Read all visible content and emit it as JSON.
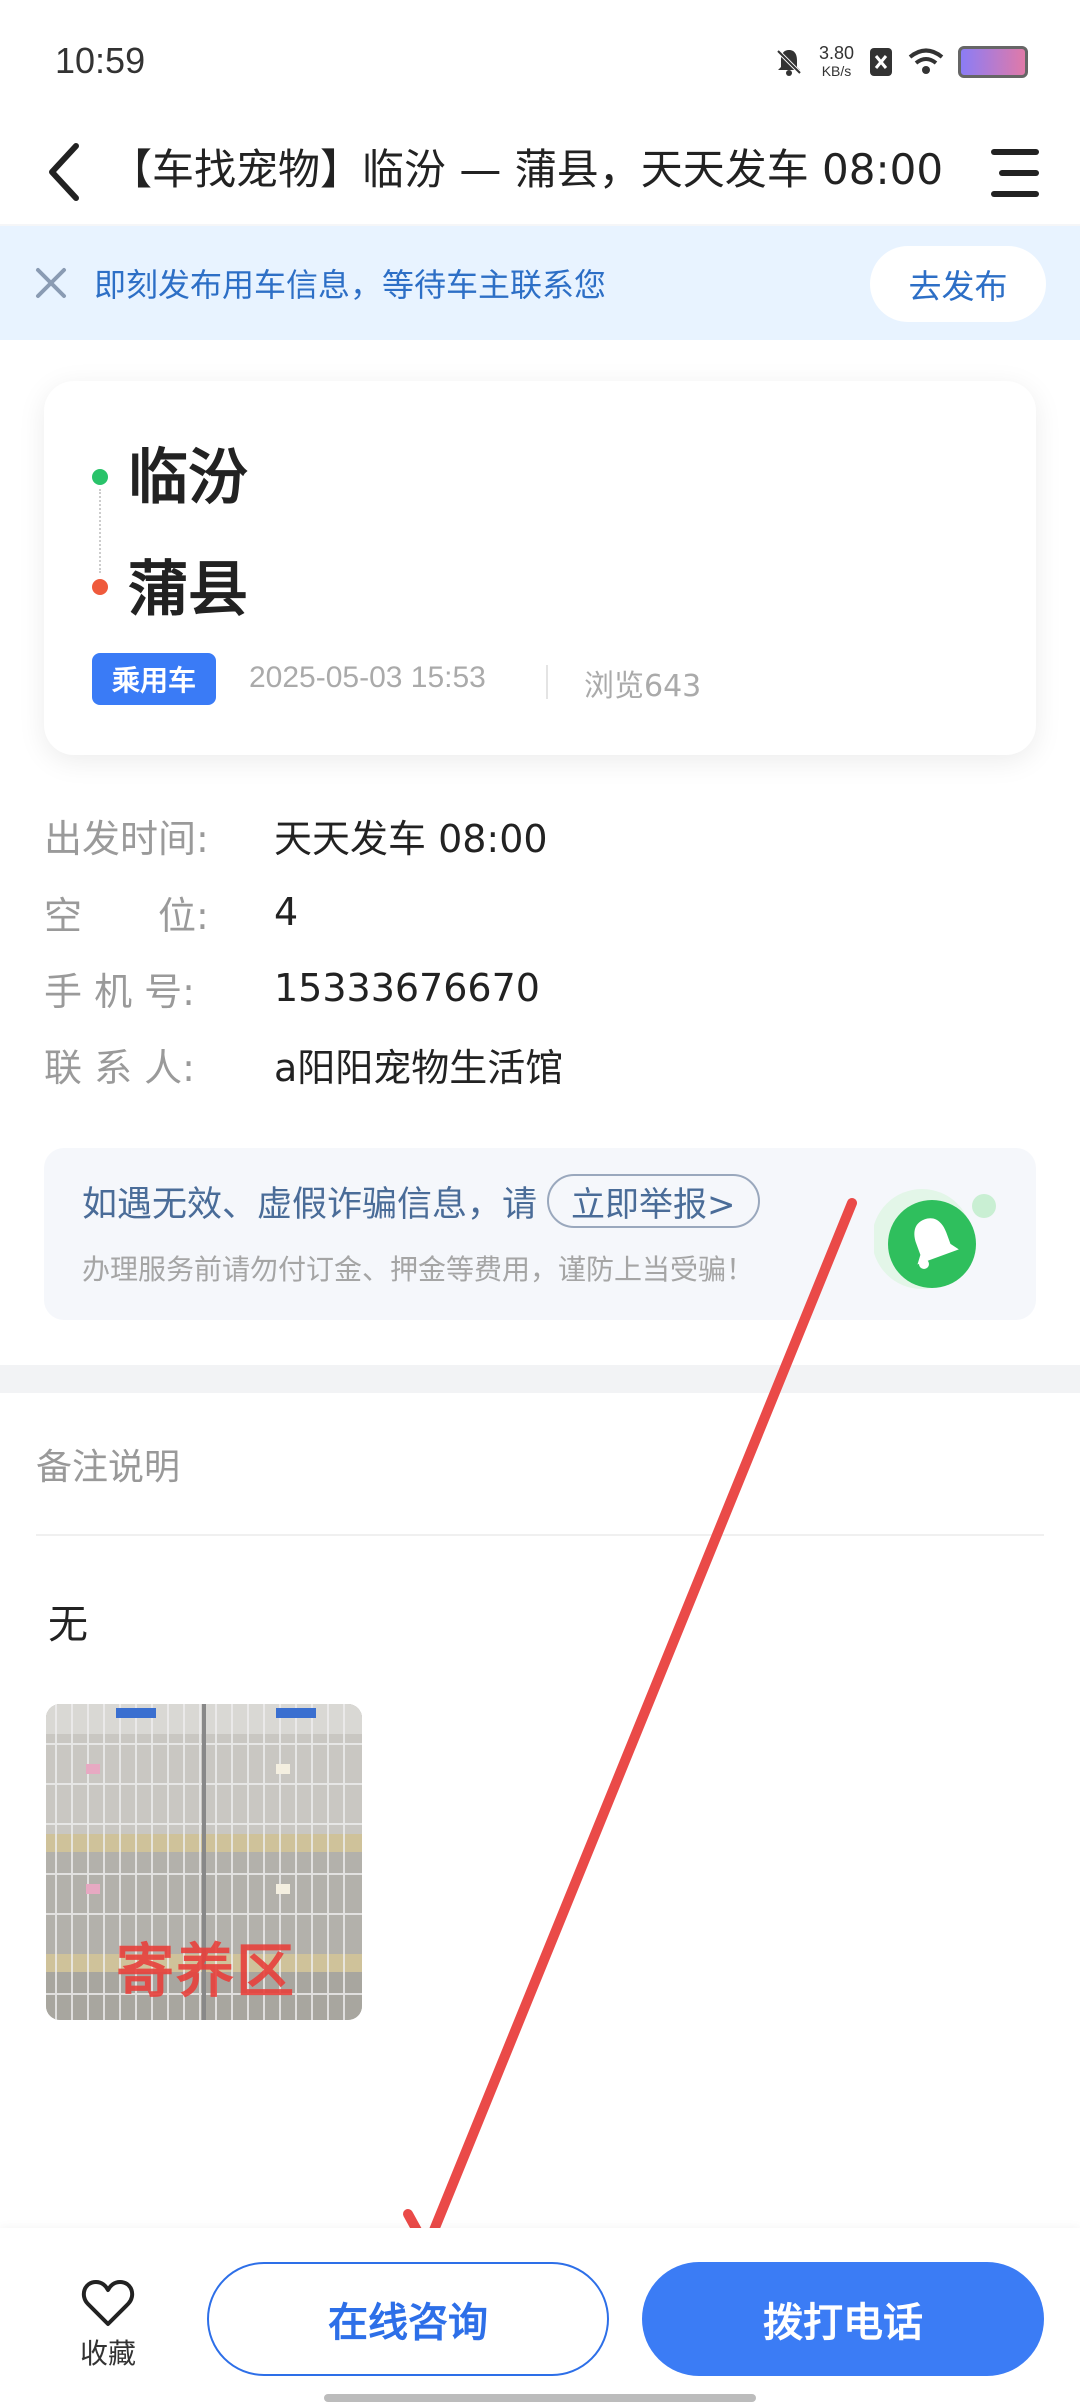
{
  "status_bar": {
    "time": "10:59",
    "net_speed_value": "3.80",
    "net_speed_unit": "KB/s"
  },
  "header": {
    "title": "【车找宠物】临汾 — 蒲县，天天发车 08:00"
  },
  "banner": {
    "text": "即刻发布用车信息，等待车主联系您",
    "button_label": "去发布"
  },
  "route": {
    "from": "临汾",
    "to": "蒲县",
    "vehicle_tag": "乘用车",
    "posted_at": "2025-05-03 15:53",
    "views": "浏览643"
  },
  "details": [
    {
      "label": "出发时间:",
      "value": "天天发车 08:00"
    },
    {
      "label": "空　　位:",
      "value": "4"
    },
    {
      "label": "手 机 号:",
      "value": "15333676670"
    },
    {
      "label": "联 系 人:",
      "value": "a阳阳宠物生活馆"
    }
  ],
  "warning": {
    "line1": "如遇无效、虚假诈骗信息，请",
    "report_label": "立即举报>",
    "line2": "办理服务前请勿付订金、押金等费用，谨防上当受骗！"
  },
  "remarks": {
    "title": "备注说明",
    "text": "无",
    "photo_label": "寄养区"
  },
  "bottom_bar": {
    "favorite_label": "收藏",
    "consult_label": "在线咨询",
    "call_label": "拨打电话"
  },
  "colors": {
    "primary": "#3b7cf5",
    "banner_bg": "#e8f3ff",
    "arrow": "#ea4a48",
    "from_dot": "#29c36a",
    "to_dot": "#ef5a3c"
  }
}
